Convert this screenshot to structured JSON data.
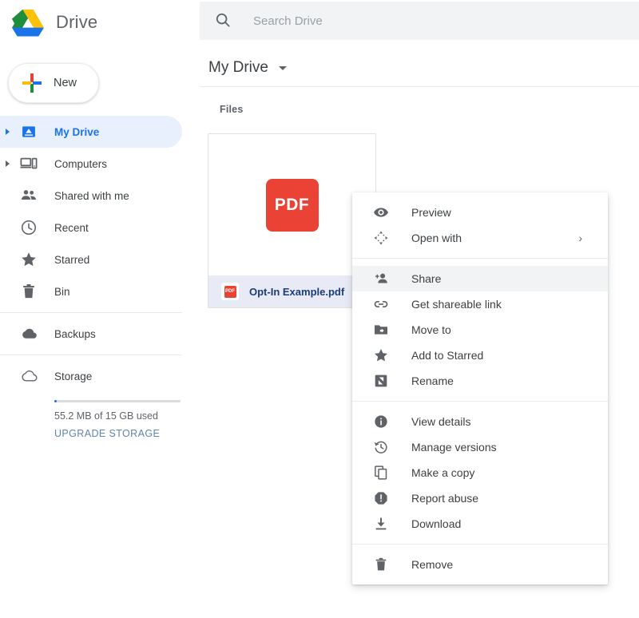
{
  "app": {
    "name": "Drive",
    "logo_icon": "google-drive-logo"
  },
  "sidebar": {
    "new_button": {
      "label": "New",
      "icon": "plus-icon"
    },
    "items": [
      {
        "label": "My Drive",
        "icon": "my-drive-icon",
        "active": true,
        "expandable": true
      },
      {
        "label": "Computers",
        "icon": "computers-icon",
        "active": false,
        "expandable": true
      },
      {
        "label": "Shared with me",
        "icon": "people-icon",
        "active": false,
        "expandable": false
      },
      {
        "label": "Recent",
        "icon": "clock-icon",
        "active": false,
        "expandable": false
      },
      {
        "label": "Starred",
        "icon": "star-icon",
        "active": false,
        "expandable": false
      },
      {
        "label": "Bin",
        "icon": "trash-icon",
        "active": false,
        "expandable": false
      }
    ],
    "backups": {
      "label": "Backups",
      "icon": "cloud-filled-icon"
    },
    "storage": {
      "label": "Storage",
      "icon": "cloud-outline-icon",
      "usage_text": "55.2 MB of 15 GB used",
      "upgrade_label": "UPGRADE STORAGE",
      "used_percent": 0.36
    }
  },
  "header": {
    "search": {
      "placeholder": "Search Drive",
      "value": "",
      "icon": "search-icon"
    },
    "breadcrumb": {
      "title": "My Drive",
      "caret_icon": "chevron-down-icon"
    }
  },
  "main": {
    "section_label": "Files",
    "file": {
      "name": "Opt-In Example.pdf",
      "type_badge": "PDF",
      "thumb_icon": "pdf-file-icon",
      "selected": true
    }
  },
  "context_menu": {
    "groups": [
      {
        "items": [
          {
            "label": "Preview",
            "icon": "eye-icon",
            "highlight": false,
            "submenu": false
          },
          {
            "label": "Open with",
            "icon": "open-with-icon",
            "highlight": false,
            "submenu": true,
            "submenu_arrow": "›"
          }
        ]
      },
      {
        "items": [
          {
            "label": "Share",
            "icon": "person-add-icon",
            "highlight": true,
            "submenu": false
          },
          {
            "label": "Get shareable link",
            "icon": "link-icon",
            "highlight": false,
            "submenu": false
          },
          {
            "label": "Move to",
            "icon": "move-to-icon",
            "highlight": false,
            "submenu": false
          },
          {
            "label": "Add to Starred",
            "icon": "star-icon",
            "highlight": false,
            "submenu": false
          },
          {
            "label": "Rename",
            "icon": "rename-icon",
            "highlight": false,
            "submenu": false
          }
        ]
      },
      {
        "items": [
          {
            "label": "View details",
            "icon": "info-icon",
            "highlight": false,
            "submenu": false
          },
          {
            "label": "Manage versions",
            "icon": "history-icon",
            "highlight": false,
            "submenu": false
          },
          {
            "label": "Make a copy",
            "icon": "copy-icon",
            "highlight": false,
            "submenu": false
          },
          {
            "label": "Report abuse",
            "icon": "report-abuse-icon",
            "highlight": false,
            "submenu": false
          },
          {
            "label": "Download",
            "icon": "download-icon",
            "highlight": false,
            "submenu": false
          }
        ]
      },
      {
        "items": [
          {
            "label": "Remove",
            "icon": "trash-icon",
            "highlight": false,
            "submenu": false
          }
        ]
      }
    ]
  },
  "colors": {
    "accent_blue": "#1a73e8",
    "pdf_red": "#ea4335",
    "selected_row": "#e8eaf6",
    "active_nav": "#e8f0fe",
    "search_bg": "#f1f3f4"
  }
}
